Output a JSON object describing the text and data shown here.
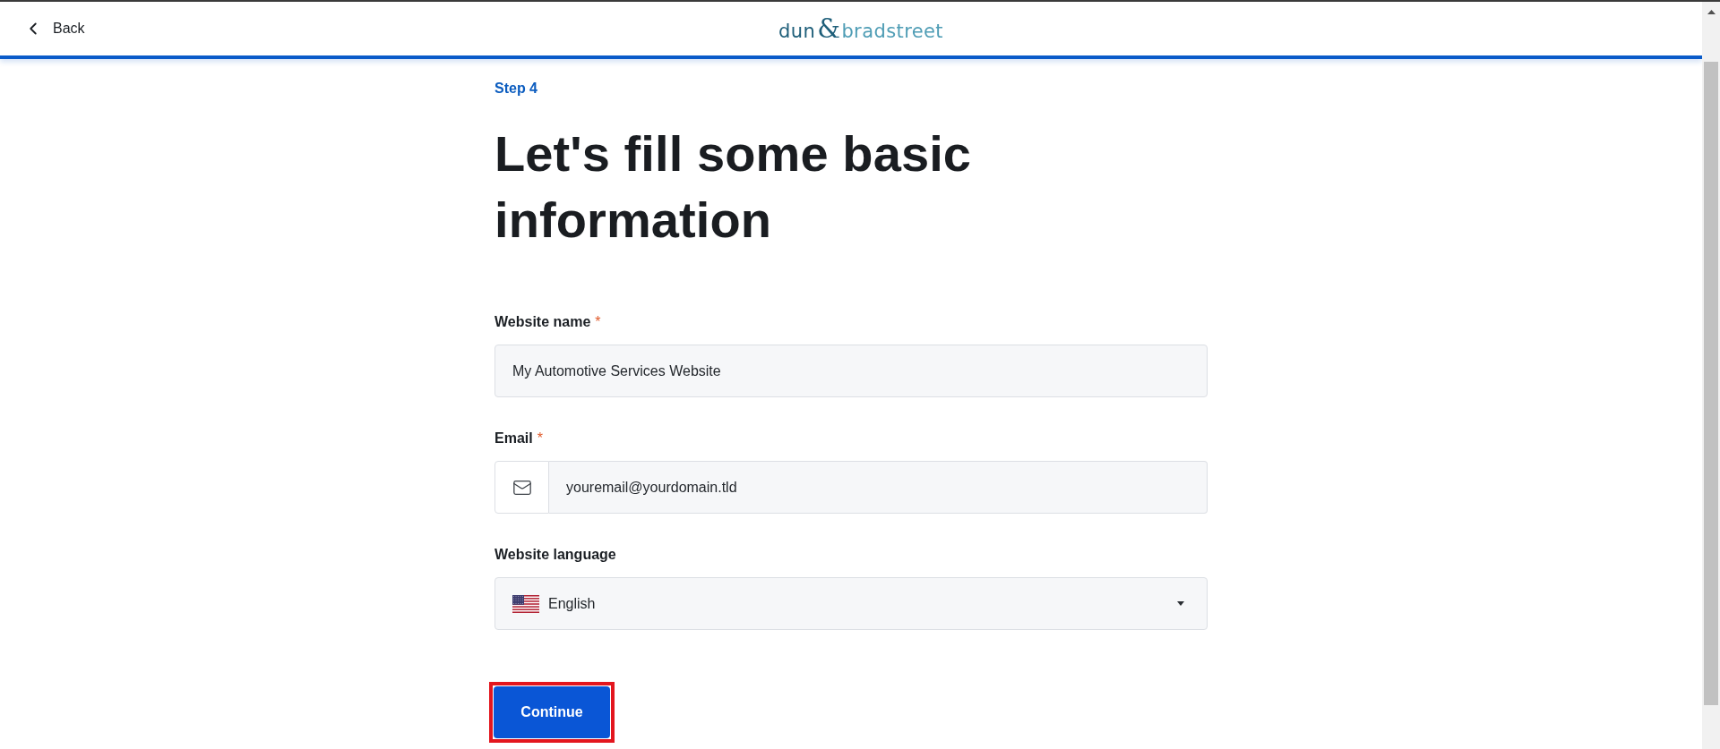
{
  "header": {
    "back_label": "Back",
    "logo": [
      "dun",
      "&",
      "bradstreet"
    ]
  },
  "step": "Step 4",
  "heading": "Let's fill some basic information",
  "fields": [
    {
      "kind": "text",
      "label": "Website name",
      "required_mark": "*",
      "value": "My Automotive Services Website"
    },
    {
      "kind": "email",
      "label": "Email",
      "required_mark": "*",
      "value": "youremail@yourdomain.tld"
    },
    {
      "kind": "select",
      "label": "Website language",
      "value": "English"
    }
  ],
  "continue_button": {
    "label": "Continue",
    "highlighted": true
  }
}
